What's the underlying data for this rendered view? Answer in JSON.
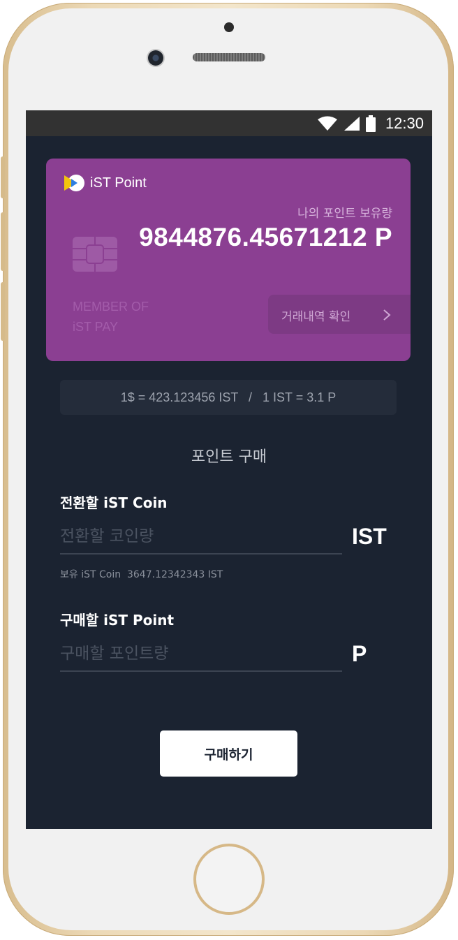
{
  "status_bar": {
    "time": "12:30"
  },
  "card": {
    "brand": "iST Point",
    "balance_caption": "나의 포인트 보유량",
    "balance_value": "9844876.45671212 P",
    "member_line1": "MEMBER OF",
    "member_line2": "iST PAY",
    "history_button": "거래내역 확인"
  },
  "exchange_rate": "1$ = 423.123456 IST   /   1 IST = 3.1 P",
  "purchase": {
    "section_title": "포인트 구매",
    "coin_field": {
      "label": "전환할  iST Coin",
      "placeholder": "전환할 코인량",
      "value": "",
      "unit": "IST",
      "holding": "보유 iST Coin  3647.12342343 IST"
    },
    "point_field": {
      "label": "구매할  iST Point",
      "placeholder": "구매할 포인트량",
      "value": "",
      "unit": "P"
    },
    "buy_button": "구매하기"
  },
  "colors": {
    "screen_bg": "#1b2331",
    "card": "#8b3f92",
    "status_bar": "#323232",
    "button_bg": "#ffffff"
  }
}
